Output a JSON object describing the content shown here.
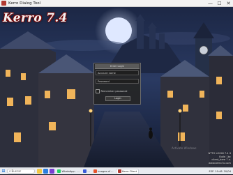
{
  "window": {
    "title": "Kerro Dialog Tool",
    "controls": {
      "minimize": "—",
      "maximize": "☐",
      "close": "✕"
    }
  },
  "game": {
    "logo": "Kerro 7.4",
    "watermark": "Activate Windows",
    "version_lines": [
      "NTTO LOGIN 7.4.3",
      "Build 1bc",
      "client_here 7.x.",
      "www.kerro7x.com"
    ]
  },
  "login": {
    "title": "Enter Login",
    "account_placeholder": "Account name",
    "password_placeholder": "Password",
    "remember_label": "Remember password",
    "remember_checked": false,
    "login_button": "Login"
  },
  "taskbar": {
    "start_icon": "windows-icon",
    "search_text": "Buscar",
    "apps": [
      {
        "label": "WhatsApp - ...",
        "color": "#25d366",
        "active": false
      },
      {
        "label": "...",
        "color": "#3b5bd9",
        "active": false
      },
      {
        "label": "images of ...",
        "color": "#e8552d",
        "active": false
      },
      {
        "label": "Kerro Client",
        "color": "#b23a32",
        "active": true
      }
    ],
    "tray": {
      "lang": "ESP",
      "time": "10:48",
      "date": "20/04"
    }
  },
  "colors": {
    "logo_outline": "#7a0c0c",
    "dialog_bg": "#262626",
    "moon": "#dfe8ff"
  }
}
